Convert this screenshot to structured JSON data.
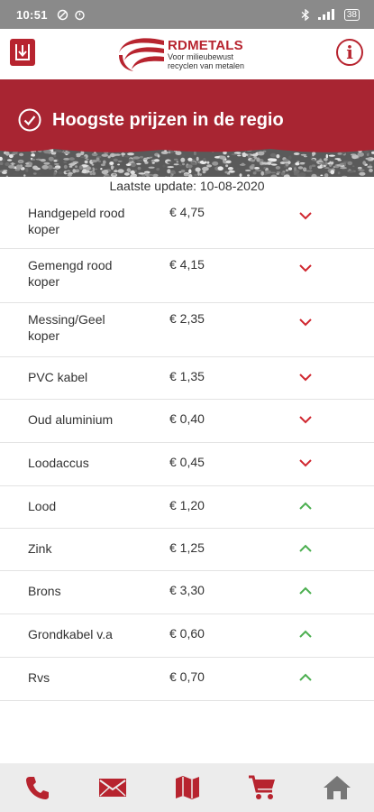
{
  "status_bar": {
    "time": "10:51",
    "battery": "38"
  },
  "header": {
    "logo_title": "RDMETALS",
    "logo_subtitle_line1": "Voor milieubewust",
    "logo_subtitle_line2": "recyclen van metalen",
    "info_label": "i",
    "download_icon": "download-icon"
  },
  "banner": {
    "title": "Hoogste prijzen in de regio",
    "icon": "check-circle-icon"
  },
  "update": {
    "text": "Laatste update: 10-08-2020"
  },
  "prices": [
    {
      "name": "Handgepeld rood koper",
      "price": "€ 4,75",
      "trend": "down"
    },
    {
      "name": "Gemengd rood koper",
      "price": "€ 4,15",
      "trend": "down"
    },
    {
      "name": "Messing/Geel koper",
      "price": "€ 2,35",
      "trend": "down"
    },
    {
      "name": "PVC kabel",
      "price": "€ 1,35",
      "trend": "down"
    },
    {
      "name": "Oud aluminium",
      "price": "€ 0,40",
      "trend": "down"
    },
    {
      "name": "Loodaccus",
      "price": "€ 0,45",
      "trend": "down"
    },
    {
      "name": "Lood",
      "price": "€ 1,20",
      "trend": "up"
    },
    {
      "name": "Zink",
      "price": "€ 1,25",
      "trend": "up"
    },
    {
      "name": "Brons",
      "price": "€ 3,30",
      "trend": "up"
    },
    {
      "name": "Grondkabel v.a",
      "price": "€ 0,60",
      "trend": "up"
    },
    {
      "name": "Rvs",
      "price": "€ 0,70",
      "trend": "up"
    }
  ],
  "colors": {
    "brand": "#b7242f",
    "down": "#d0262f",
    "up": "#4caf50"
  },
  "footer": {
    "items": [
      "phone-icon",
      "mail-icon",
      "map-icon",
      "cart-icon",
      "home-icon"
    ]
  }
}
